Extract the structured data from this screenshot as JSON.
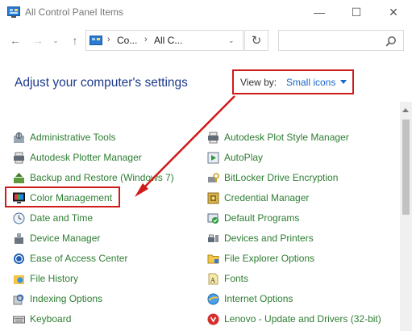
{
  "window": {
    "title": "All Control Panel Items"
  },
  "titlebar_buttons": {
    "minimize": "—",
    "maximize": "☐",
    "close": "✕"
  },
  "nav": {
    "back": "←",
    "forward": "→",
    "recent": "⌄",
    "up": "↑"
  },
  "address": {
    "chevron": "›",
    "segment1": "Co...",
    "segment2": "All C...",
    "dropdown": "⌄",
    "refresh": "↻"
  },
  "search": {
    "placeholder": ""
  },
  "heading": "Adjust your computer's settings",
  "view_by": {
    "label": "View by:",
    "value": "Small icons"
  },
  "items_left": [
    {
      "label": "Administrative Tools",
      "icon": "admin-tools-icon"
    },
    {
      "label": "Autodesk Plotter Manager",
      "icon": "plotter-icon"
    },
    {
      "label": "Backup and Restore (Windows 7)",
      "icon": "backup-icon"
    },
    {
      "label": "Color Management",
      "icon": "color-management-icon"
    },
    {
      "label": "Date and Time",
      "icon": "clock-icon"
    },
    {
      "label": "Device Manager",
      "icon": "device-manager-icon"
    },
    {
      "label": "Ease of Access Center",
      "icon": "ease-of-access-icon"
    },
    {
      "label": "File History",
      "icon": "file-history-icon"
    },
    {
      "label": "Indexing Options",
      "icon": "indexing-icon"
    },
    {
      "label": "Keyboard",
      "icon": "keyboard-icon"
    }
  ],
  "items_right": [
    {
      "label": "Autodesk Plot Style Manager",
      "icon": "printer-icon"
    },
    {
      "label": "AutoPlay",
      "icon": "autoplay-icon"
    },
    {
      "label": "BitLocker Drive Encryption",
      "icon": "bitlocker-icon"
    },
    {
      "label": "Credential Manager",
      "icon": "credential-icon"
    },
    {
      "label": "Default Programs",
      "icon": "default-programs-icon"
    },
    {
      "label": "Devices and Printers",
      "icon": "devices-printers-icon"
    },
    {
      "label": "File Explorer Options",
      "icon": "folder-options-icon"
    },
    {
      "label": "Fonts",
      "icon": "fonts-icon"
    },
    {
      "label": "Internet Options",
      "icon": "internet-options-icon"
    },
    {
      "label": "Lenovo - Update and Drivers (32-bit)",
      "icon": "lenovo-update-icon"
    }
  ],
  "colors": {
    "link_green": "#2e7d32",
    "heading_blue": "#1e3a8c",
    "accent_blue": "#1a66cc",
    "annotation_red": "#d01b1b"
  }
}
